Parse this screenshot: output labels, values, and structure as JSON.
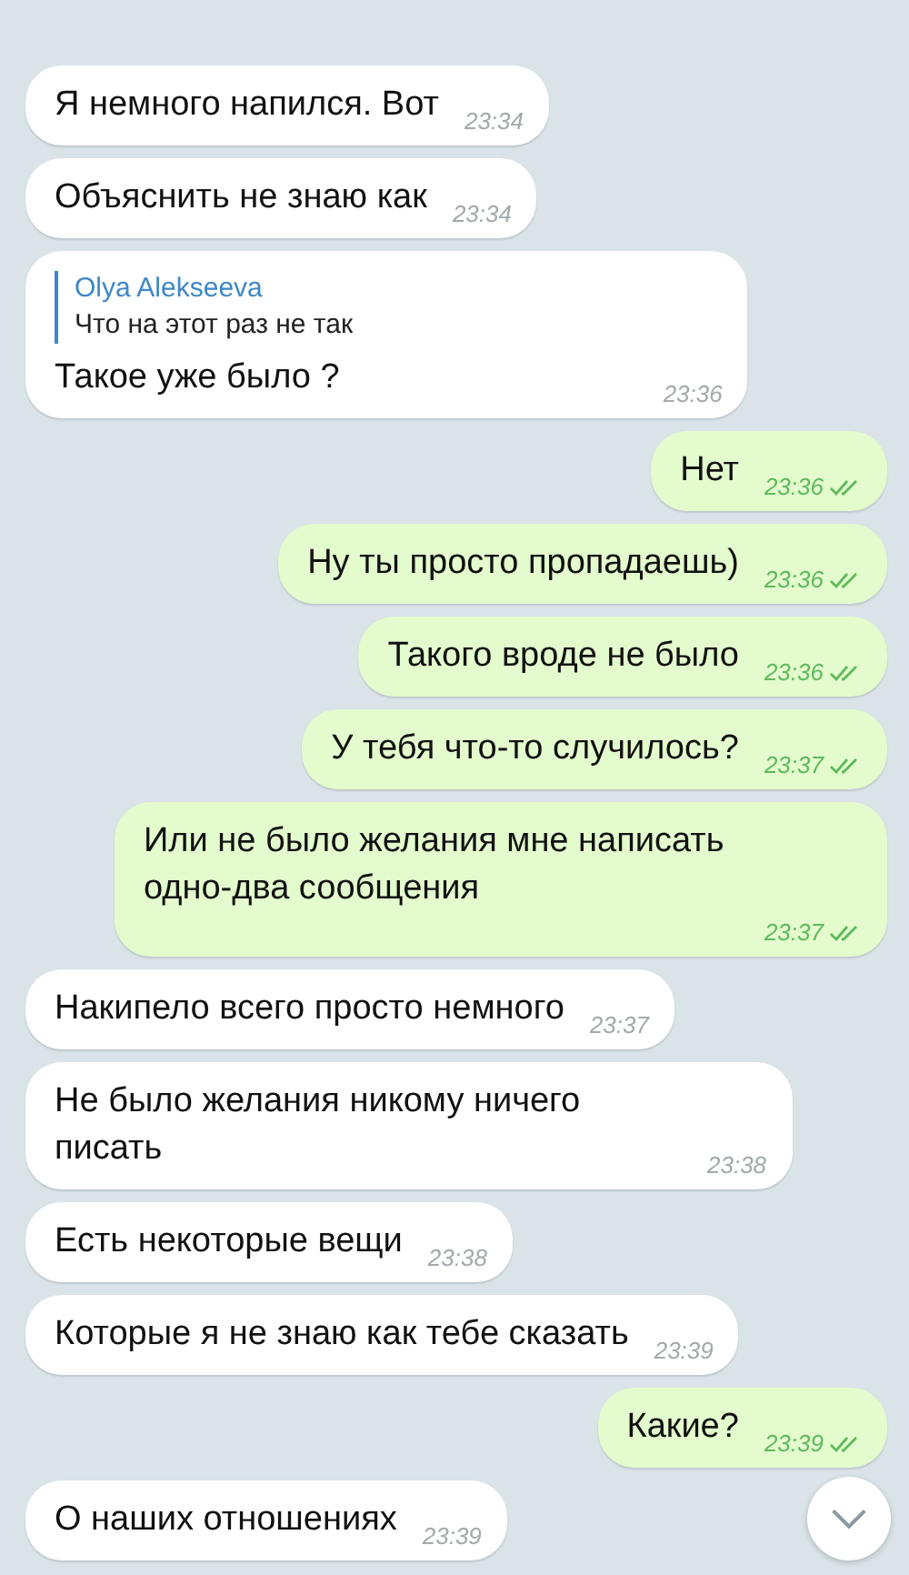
{
  "messages": [
    {
      "kind": "incoming",
      "text": "Я немного напился. Вот",
      "time": "23:34"
    },
    {
      "kind": "incoming",
      "text": "Объяснить не знаю как",
      "time": "23:34"
    },
    {
      "kind": "incoming",
      "reply": {
        "author": "Olya Alekseeva",
        "text": "Что на этот раз не так"
      },
      "text": "Такое уже было ?",
      "time": "23:36"
    },
    {
      "kind": "outgoing",
      "text": "Нет",
      "time": "23:36",
      "read": true
    },
    {
      "kind": "outgoing",
      "text": "Ну ты просто пропадаешь)",
      "time": "23:36",
      "read": true
    },
    {
      "kind": "outgoing",
      "text": "Такого вроде не было",
      "time": "23:36",
      "read": true
    },
    {
      "kind": "outgoing",
      "text": "У тебя что-то случилось?",
      "time": "23:37",
      "read": true
    },
    {
      "kind": "outgoing",
      "text": "Или не было желания мне написать одно-два сообщения",
      "time": "23:37",
      "read": true
    },
    {
      "kind": "incoming",
      "text": "Накипело всего просто немного",
      "time": "23:37"
    },
    {
      "kind": "incoming",
      "text": "Не было желания никому ничего писать",
      "time": "23:38"
    },
    {
      "kind": "incoming",
      "text": "Есть некоторые вещи",
      "time": "23:38"
    },
    {
      "kind": "incoming",
      "text": "Которые я не знаю как тебе сказать",
      "time": "23:39"
    },
    {
      "kind": "outgoing",
      "text": "Какие?",
      "time": "23:39",
      "read": true
    },
    {
      "kind": "incoming",
      "text": "О наших отношениях",
      "time": "23:39"
    }
  ]
}
